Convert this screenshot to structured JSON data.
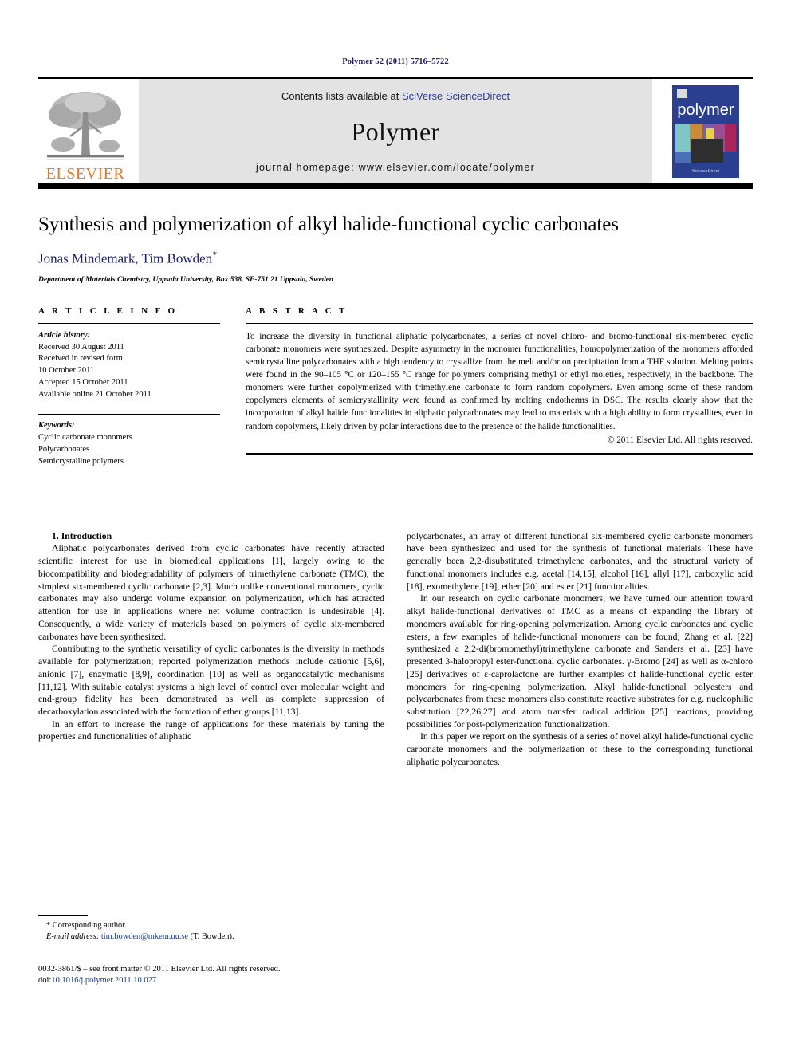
{
  "running_head": "Polymer 52 (2011) 5716–5722",
  "masthead": {
    "publisher_name": "ELSEVIER",
    "contents_prefix": "Contents lists available at ",
    "contents_link": "SciVerse ScienceDirect",
    "journal_name": "Polymer",
    "homepage_label": "journal homepage: www.elsevier.com/locate/polymer",
    "cover_word": "polymer",
    "cover_footer": "ScienceDirect",
    "link_color": "#2b3a8f"
  },
  "title_block": {
    "title": "Synthesis and polymerization of alkyl halide-functional cyclic carbonates",
    "authors": "Jonas Mindemark, Tim Bowden",
    "corresponding_marker": "*",
    "affiliation": "Department of Materials Chemistry, Uppsala University, Box 538, SE-751 21 Uppsala, Sweden"
  },
  "article_info": {
    "heading": "A R T I C L E   I N F O",
    "history_label": "Article history:",
    "history": [
      "Received 30 August 2011",
      "Received in revised form",
      "10 October 2011",
      "Accepted 15 October 2011",
      "Available online 21 October 2011"
    ],
    "keywords_label": "Keywords:",
    "keywords": [
      "Cyclic carbonate monomers",
      "Polycarbonates",
      "Semicrystalline polymers"
    ]
  },
  "abstract": {
    "heading": "A B S T R A C T",
    "text": "To increase the diversity in functional aliphatic polycarbonates, a series of novel chloro- and bromo-functional six-membered cyclic carbonate monomers were synthesized. Despite asymmetry in the monomer functionalities, homopolymerization of the monomers afforded semicrystalline polycarbonates with a high tendency to crystallize from the melt and/or on precipitation from a THF solution. Melting points were found in the 90–105 °C or 120–155 °C range for polymers comprising methyl or ethyl moieties, respectively, in the backbone. The monomers were further copolymerized with trimethylene carbonate to form random copolymers. Even among some of these random copolymers elements of semicrystallinity were found as confirmed by melting endotherms in DSC. The results clearly show that the incorporation of alkyl halide functionalities in aliphatic polycarbonates may lead to materials with a high ability to form crystallites, even in random copolymers, likely driven by polar interactions due to the presence of the halide functionalities.",
    "copyright": "© 2011 Elsevier Ltd. All rights reserved."
  },
  "body": {
    "section_number_title": "1. Introduction",
    "left_paragraphs": [
      "Aliphatic polycarbonates derived from cyclic carbonates have recently attracted scientific interest for use in biomedical applications [1], largely owing to the biocompatibility and biodegradability of polymers of trimethylene carbonate (TMC), the simplest six-membered cyclic carbonate [2,3]. Much unlike conventional monomers, cyclic carbonates may also undergo volume expansion on polymerization, which has attracted attention for use in applications where net volume contraction is undesirable [4]. Consequently, a wide variety of materials based on polymers of cyclic six-membered carbonates have been synthesized.",
      "Contributing to the synthetic versatility of cyclic carbonates is the diversity in methods available for polymerization; reported polymerization methods include cationic [5,6], anionic [7], enzymatic [8,9], coordination [10] as well as organocatalytic mechanisms [11,12]. With suitable catalyst systems a high level of control over molecular weight and end-group fidelity has been demonstrated as well as complete suppression of decarboxylation associated with the formation of ether groups [11,13].",
      "In an effort to increase the range of applications for these materials by tuning the properties and functionalities of aliphatic"
    ],
    "right_paragraphs": [
      "polycarbonates, an array of different functional six-membered cyclic carbonate monomers have been synthesized and used for the synthesis of functional materials. These have generally been 2,2-disubstituted trimethylene carbonates, and the structural variety of functional monomers includes e.g. acetal [14,15], alcohol [16], allyl [17], carboxylic acid [18], exomethylene [19], ether [20] and ester [21] functionalities.",
      "In our research on cyclic carbonate monomers, we have turned our attention toward alkyl halide-functional derivatives of TMC as a means of expanding the library of monomers available for ring-opening polymerization. Among cyclic carbonates and cyclic esters, a few examples of halide-functional monomers can be found; Zhang et al. [22] synthesized a 2,2-di(bromomethyl)trimethylene carbonate and Sanders et al. [23] have presented 3-halopropyl ester-functional cyclic carbonates. γ-Bromo [24] as well as α-chloro [25] derivatives of ε-caprolactone are further examples of halide-functional cyclic ester monomers for ring-opening polymerization. Alkyl halide-functional polyesters and polycarbonates from these monomers also constitute reactive substrates for e.g. nucleophilic substitution [22,26,27] and atom transfer radical addition [25] reactions, providing possibilities for post-polymerization functionalization.",
      "In this paper we report on the synthesis of a series of novel alkyl halide-functional cyclic carbonate monomers and the polymerization of these to the corresponding functional aliphatic polycarbonates."
    ]
  },
  "footnote": {
    "corresponding_author": "* Corresponding author.",
    "email_label": "E-mail address:",
    "email": "tim.bowden@mkem.uu.se",
    "email_suffix": "(T. Bowden)."
  },
  "imprint": {
    "issn_line": "0032-3861/$ – see front matter © 2011 Elsevier Ltd. All rights reserved.",
    "doi_prefix": "doi:",
    "doi": "10.1016/j.polymer.2011.10.027"
  }
}
